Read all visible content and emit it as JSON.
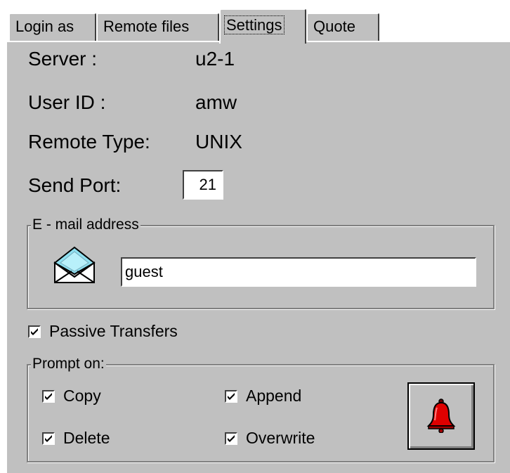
{
  "tabs": [
    {
      "label": "Login as"
    },
    {
      "label": "Remote files"
    },
    {
      "label": "Settings"
    },
    {
      "label": "Quote"
    }
  ],
  "active_tab": "Settings",
  "info": {
    "server_label": "Server :",
    "server_value": "u2-1",
    "user_label": "User ID :",
    "user_value": "amw",
    "type_label": "Remote Type:",
    "type_value": "UNIX",
    "port_label": "Send Port:",
    "port_value": "21"
  },
  "email": {
    "group_title": "E - mail address",
    "value": "guest",
    "icon": "envelope-icon"
  },
  "passive": {
    "label": "Passive Transfers",
    "checked": true
  },
  "prompt": {
    "group_title": "Prompt on:",
    "options": [
      {
        "label": "Copy",
        "checked": true
      },
      {
        "label": "Append",
        "checked": true
      },
      {
        "label": "Delete",
        "checked": true
      },
      {
        "label": "Overwrite",
        "checked": true
      }
    ],
    "bell_icon": "bell-icon"
  },
  "colors": {
    "face": "#c0c0c0",
    "bell": "#e00000"
  }
}
